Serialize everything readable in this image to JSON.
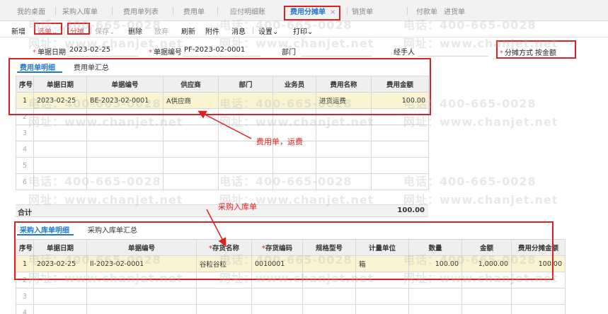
{
  "tabs": [
    {
      "label": "我的桌面"
    },
    {
      "label": "采购入库单"
    },
    {
      "label": "费用单列表"
    },
    {
      "label": "费用单"
    },
    {
      "label": "应付明细账"
    },
    {
      "label": "费用分摊单",
      "active": true,
      "close": "×"
    },
    {
      "label": "销货单"
    },
    {
      "label": "付款单"
    },
    {
      "label": "进货单"
    }
  ],
  "toolbar": {
    "new": "新增",
    "select": "选单",
    "allocate": "分摊",
    "save": "保存",
    "delete": "删除",
    "abandon": "放弃",
    "refresh": "刷新",
    "attach": "附件",
    "message": "消息",
    "settings": "设置",
    "print": "打印"
  },
  "form": {
    "date_label": "单据日期",
    "date_value": "2023-02-25",
    "no_label": "单据编号",
    "no_value": "PF-2023-02-0001",
    "dept_label": "部门",
    "handler_label": "经手人",
    "method_label": "分摊方式",
    "method_value": "按金额"
  },
  "expense": {
    "tab_detail": "费用单明细",
    "tab_summary": "费用单汇总",
    "columns": [
      "序号",
      "单据日期",
      "单据编号",
      "供应商",
      "部门",
      "业务员",
      "费用名称",
      "费用金额"
    ],
    "rows": [
      {
        "idx": "1",
        "date": "2023-02-25",
        "no": "BE-2023-02-0001",
        "supplier": "A供应商",
        "dept": "",
        "staff": "",
        "fee": "进货运费",
        "amount": "100.00"
      }
    ],
    "empty_rows": [
      "2",
      "3",
      "4",
      "5",
      "6"
    ]
  },
  "total": {
    "label": "合计",
    "value": "100.00"
  },
  "purchase": {
    "tab_detail": "采购入库单明细",
    "tab_summary": "采购入库单汇总",
    "columns": [
      "序号",
      "单据日期",
      "单据编号",
      "存货名称",
      "存货编码",
      "规格型号",
      "计量单位",
      "数量",
      "金额",
      "费用分摊金额"
    ],
    "required_columns": [
      3,
      4
    ],
    "rows": [
      {
        "idx": "1",
        "date": "2023-02-25",
        "no": "II-2023-02-0001",
        "name": "谷粒谷粒",
        "code": "0010001",
        "spec": "",
        "unit": "箱",
        "qty": "100.00",
        "amount": "1,000.00",
        "alloc": "100.00"
      }
    ],
    "empty_rows": [
      "2",
      "3",
      "4"
    ]
  },
  "annotations": {
    "expense_note": "费用单，运费",
    "purchase_note": "采购入库单"
  },
  "watermark": {
    "phone": "电话：400-665-0028",
    "site": "网址：www.chanjet.net"
  },
  "colors": {
    "accent": "#1f77d0",
    "highlight": "#e02020",
    "selected_row": "#fbf4d2"
  }
}
